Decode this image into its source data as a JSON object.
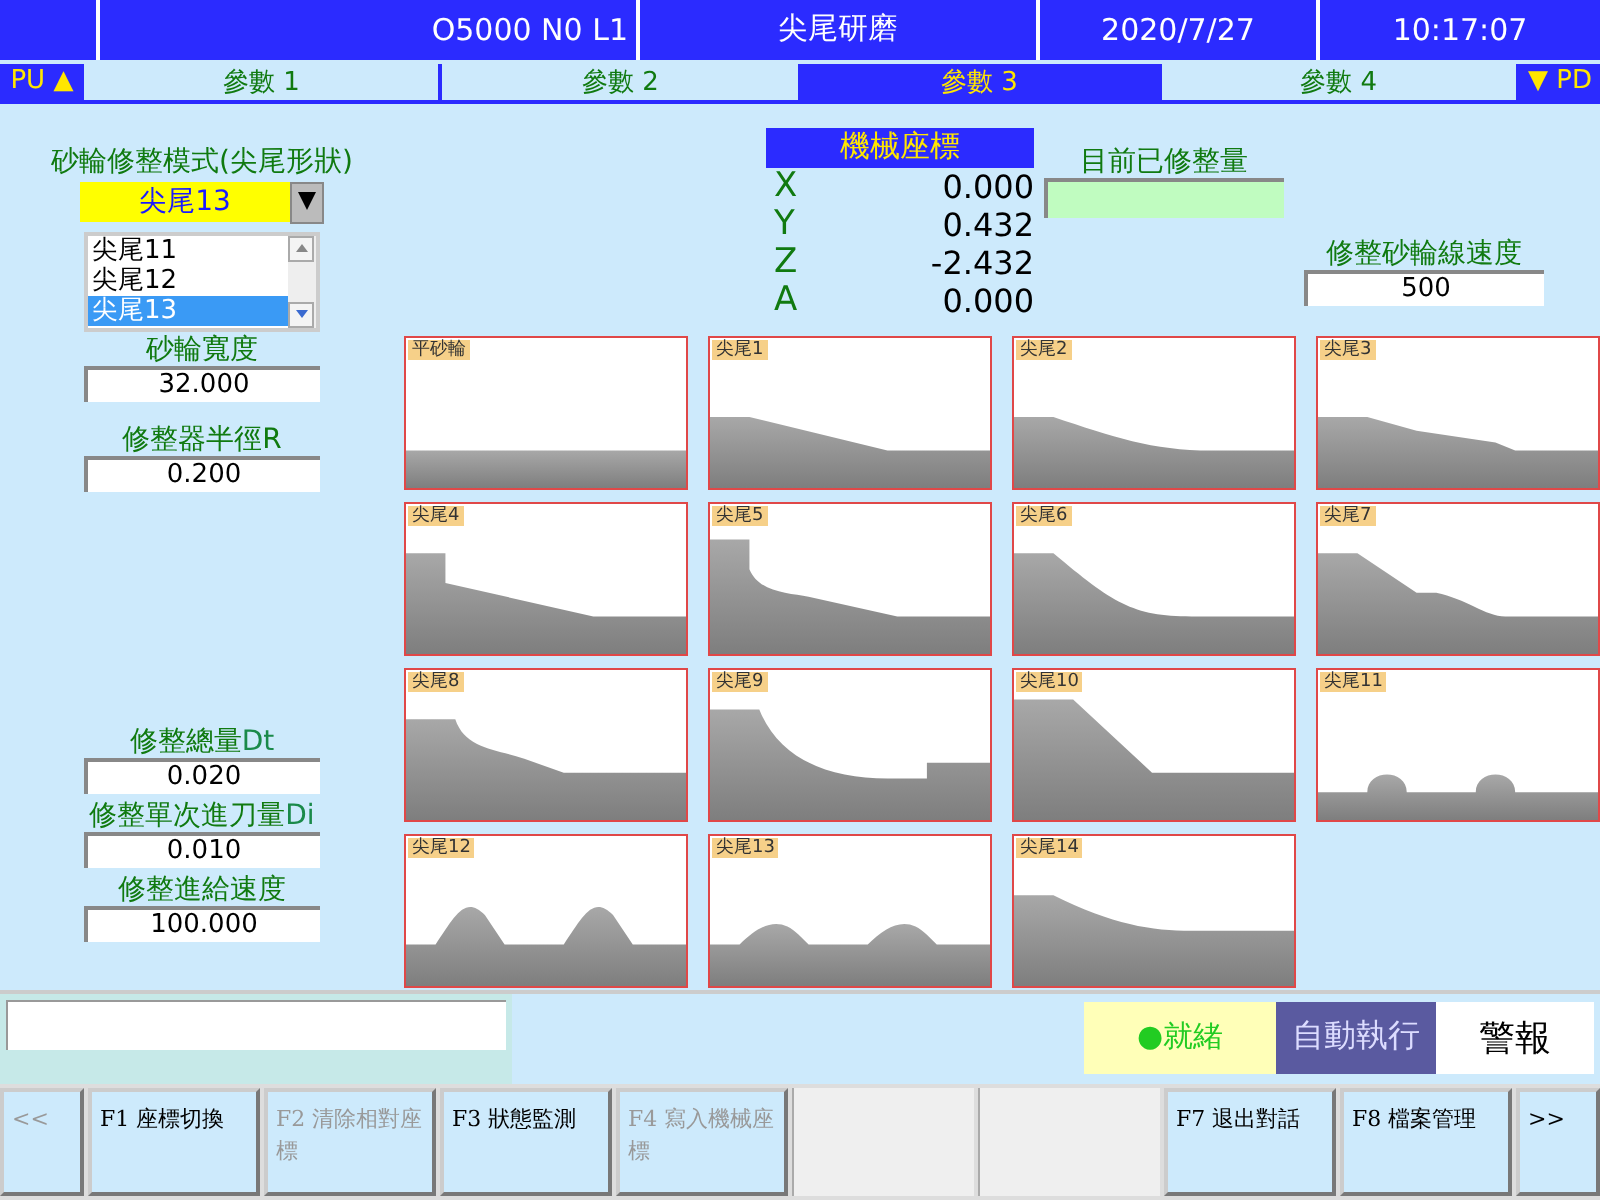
{
  "header": {
    "program": "O5000 N0 L1",
    "mode": "尖尾研磨",
    "date": "2020/7/27",
    "time": "10:17:07"
  },
  "page_up": "PU ▲",
  "page_down": "▼ PD",
  "tabs": [
    {
      "label": "參數 1",
      "selected": false
    },
    {
      "label": "參數 2",
      "selected": false
    },
    {
      "label": "參數 3",
      "selected": true
    },
    {
      "label": "參數 4",
      "selected": false
    }
  ],
  "shape_mode": {
    "label": "砂輪修整模式(尖尾形狀)",
    "value": "尖尾13",
    "options": [
      {
        "label": "尖尾11",
        "selected": false
      },
      {
        "label": "尖尾12",
        "selected": false
      },
      {
        "label": "尖尾13",
        "selected": true
      }
    ]
  },
  "left_fields": [
    {
      "label": "砂輪寬度",
      "value": "32.000"
    },
    {
      "label": "修整器半徑R",
      "value": "0.200"
    }
  ],
  "lower_fields": [
    {
      "label": "修整總量",
      "suffix": "Dt",
      "value": "0.020"
    },
    {
      "label": "修整單次進刀量",
      "suffix": "Di",
      "value": "0.010"
    },
    {
      "label": "修整進給速度",
      "value": "100.000"
    }
  ],
  "coords": {
    "title": "機械座標",
    "axes": [
      {
        "axis": "X",
        "value": "0.000"
      },
      {
        "axis": "Y",
        "value": "0.432"
      },
      {
        "axis": "Z",
        "value": "-2.432"
      },
      {
        "axis": "A",
        "value": "0.000"
      }
    ]
  },
  "dressed": {
    "label": "目前已修整量"
  },
  "wheel_speed": {
    "label": "修整砂輪線速度",
    "value": "500"
  },
  "profiles": [
    "平砂輪",
    "尖尾1",
    "尖尾2",
    "尖尾3",
    "尖尾4",
    "尖尾5",
    "尖尾6",
    "尖尾7",
    "尖尾8",
    "尖尾9",
    "尖尾10",
    "尖尾11",
    "尖尾12",
    "尖尾13",
    "尖尾14"
  ],
  "status": {
    "ready": "●就緒",
    "auto": "自動執行",
    "alarm": "警報"
  },
  "keys": [
    {
      "kind": "nav",
      "label": "<<",
      "disabled": true
    },
    {
      "kind": "key",
      "label": "F1 座標切換",
      "disabled": false
    },
    {
      "kind": "key",
      "label": "F2 清除相對座標",
      "disabled": true
    },
    {
      "kind": "key",
      "label": "F3 狀態監測",
      "disabled": false
    },
    {
      "kind": "key",
      "label": "F4 寫入機械座標",
      "disabled": true
    },
    {
      "kind": "blank"
    },
    {
      "kind": "blank"
    },
    {
      "kind": "key",
      "label": "F7 退出對話",
      "disabled": false
    },
    {
      "kind": "key",
      "label": "F8 檔案管理",
      "disabled": false
    },
    {
      "kind": "nav",
      "label": ">>",
      "disabled": false
    }
  ]
}
